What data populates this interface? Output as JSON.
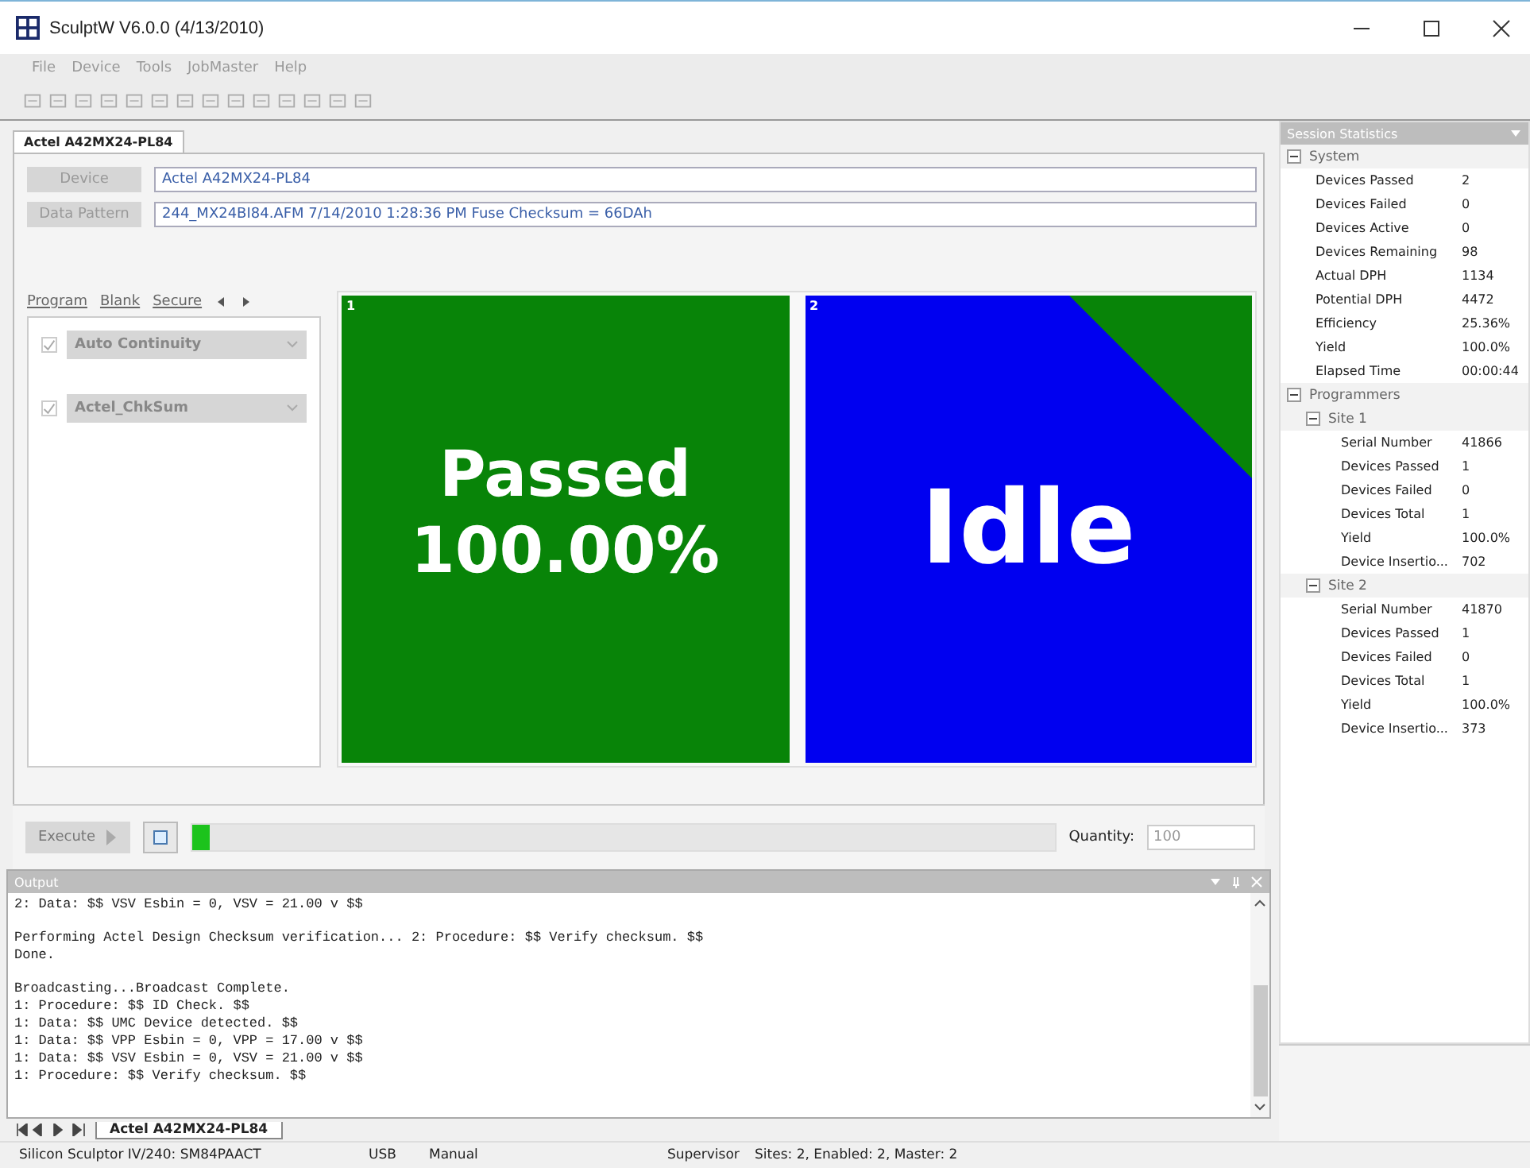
{
  "window": {
    "title": "SculptW  V6.0.0 (4/13/2010)"
  },
  "menu": [
    "File",
    "Device",
    "Tools",
    "JobMaster",
    "Help"
  ],
  "doc_tab": {
    "label": "Actel A42MX24-PL84",
    "selected": true
  },
  "fields": [
    {
      "label": "Device",
      "value": "Actel A42MX24-PL84"
    },
    {
      "label": "Data Pattern",
      "value": "244_MX24BI84.AFM   7/14/2010 1:28:36 PM   Fuse Checksum = 66DAh"
    }
  ],
  "op_tabs": [
    "Program",
    "Blank",
    "Secure"
  ],
  "options": [
    {
      "label": "Auto Continuity",
      "checked": true
    },
    {
      "label": "Actel_ChkSum",
      "checked": true
    }
  ],
  "sites": [
    {
      "number": "1",
      "kind": "passed",
      "color": "#088408",
      "lines": [
        "Passed",
        "100.00%"
      ]
    },
    {
      "number": "2",
      "kind": "idle",
      "color": "#0000f0",
      "lines": [
        "Idle"
      ]
    }
  ],
  "execute": {
    "label": "Execute",
    "disabled": true
  },
  "progress": {
    "level": 0.02
  },
  "quantity": {
    "label": "Quantity:",
    "value": "100"
  },
  "statistics": {
    "title": "Session Statistics",
    "tree": [
      {
        "kind": "group",
        "label": "System",
        "expanded": true,
        "children": [
          {
            "kind": "item",
            "label": "Devices Passed",
            "value": "2"
          },
          {
            "kind": "item",
            "label": "Devices Failed",
            "value": "0"
          },
          {
            "kind": "item",
            "label": "Devices Active",
            "value": "0"
          },
          {
            "kind": "item",
            "label": "Devices Remaining",
            "value": "98"
          },
          {
            "kind": "item",
            "label": "Actual DPH",
            "value": "1134"
          },
          {
            "kind": "item",
            "label": "Potential DPH",
            "value": "4472"
          },
          {
            "kind": "item",
            "label": "Efficiency",
            "value": "25.36%"
          },
          {
            "kind": "item",
            "label": "Yield",
            "value": "100.0%"
          },
          {
            "kind": "item",
            "label": "Elapsed Time",
            "value": "00:00:44"
          }
        ]
      },
      {
        "kind": "group",
        "label": "Programmers",
        "expanded": true,
        "children": [
          {
            "kind": "group",
            "label": "Site 1",
            "expanded": true,
            "children": [
              {
                "kind": "item",
                "label": "Serial Number",
                "value": "41866"
              },
              {
                "kind": "item",
                "label": "Devices Passed",
                "value": "1"
              },
              {
                "kind": "item",
                "label": "Devices Failed",
                "value": "0"
              },
              {
                "kind": "item",
                "label": "Devices Total",
                "value": "1"
              },
              {
                "kind": "item",
                "label": "Yield",
                "value": "100.0%"
              },
              {
                "kind": "item",
                "label": "Device Insertio...",
                "value": "702"
              }
            ]
          },
          {
            "kind": "group",
            "label": "Site 2",
            "expanded": true,
            "children": [
              {
                "kind": "item",
                "label": "Serial Number",
                "value": "41870"
              },
              {
                "kind": "item",
                "label": "Devices Passed",
                "value": "1"
              },
              {
                "kind": "item",
                "label": "Devices Failed",
                "value": "0"
              },
              {
                "kind": "item",
                "label": "Devices Total",
                "value": "1"
              },
              {
                "kind": "item",
                "label": "Yield",
                "value": "100.0%"
              },
              {
                "kind": "item",
                "label": "Device Insertio...",
                "value": "373"
              }
            ]
          }
        ]
      }
    ]
  },
  "output": {
    "title": "Output",
    "blocks": [
      [
        "2: Data: $$ VSV Esbin = 0, VSV = 21.00 v $$"
      ],
      [
        "Performing Actel Design Checksum verification... 2: Procedure: $$ Verify checksum. $$",
        "Done."
      ],
      [
        "Broadcasting...Broadcast Complete.",
        "1: Procedure: $$ ID Check. $$",
        "1: Data: $$ UMC Device detected. $$",
        "1: Data: $$ VPP Esbin = 0, VPP = 17.00 v $$",
        "1: Data: $$ VSV Esbin = 0, VSV = 21.00 v $$",
        "1: Procedure: $$ Verify checksum. $$"
      ]
    ]
  },
  "sheet_tab": {
    "label": "Actel A42MX24-PL84",
    "selected": true
  },
  "status_bar": [
    "Silicon Sculptor IV/240: SM84PAACT",
    "USB",
    "Manual",
    "Supervisor",
    "Sites: 2, Enabled: 2, Master: 2"
  ]
}
